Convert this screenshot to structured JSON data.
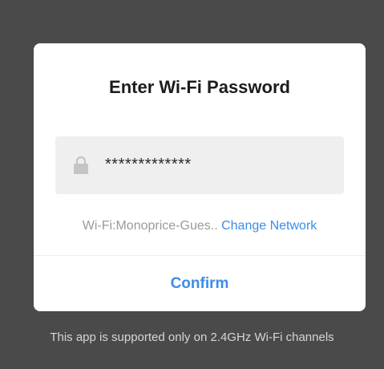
{
  "dialog": {
    "title": "Enter Wi-Fi Password",
    "password": {
      "masked_value": "*************",
      "icon": "lock-icon"
    },
    "network": {
      "label": "Wi-Fi:Monoprice-Gues..",
      "change_label": "Change Network"
    },
    "confirm_label": "Confirm"
  },
  "footer": {
    "note": "This app is supported only on 2.4GHz Wi-Fi channels"
  },
  "colors": {
    "backdrop": "#4a4a4a",
    "accent": "#3a8ee6",
    "field_bg": "#efefef"
  }
}
